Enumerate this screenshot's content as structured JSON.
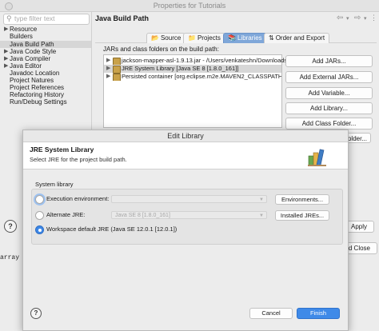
{
  "window": {
    "title": "Properties for Tutorials"
  },
  "sidebar": {
    "filter_placeholder": "type filter text",
    "items": [
      {
        "label": "Resource",
        "expandable": true
      },
      {
        "label": "Builders",
        "expandable": false
      },
      {
        "label": "Java Build Path",
        "expandable": false,
        "selected": true
      },
      {
        "label": "Java Code Style",
        "expandable": true
      },
      {
        "label": "Java Compiler",
        "expandable": true
      },
      {
        "label": "Java Editor",
        "expandable": true
      },
      {
        "label": "Javadoc Location",
        "expandable": false
      },
      {
        "label": "Project Natures",
        "expandable": false
      },
      {
        "label": "Project References",
        "expandable": false
      },
      {
        "label": "Refactoring History",
        "expandable": false
      },
      {
        "label": "Run/Debug Settings",
        "expandable": false
      }
    ]
  },
  "main": {
    "title": "Java Build Path",
    "tabs": [
      {
        "label": "Source",
        "icon": "source-folder-icon"
      },
      {
        "label": "Projects",
        "icon": "project-icon"
      },
      {
        "label": "Libraries",
        "icon": "library-icon",
        "active": true
      },
      {
        "label": "Order and Export",
        "icon": "order-icon"
      }
    ],
    "jars_label": "JARs and class folders on the build path:",
    "tree": [
      {
        "label": "jackson-mapper-asl-1.9.13.jar - /Users/venkateshn/Downloads"
      },
      {
        "label": "JRE System Library [Java SE 8 [1.8.0_161]]",
        "selected": true
      },
      {
        "label": "Persisted container [org.eclipse.m2e.MAVEN2_CLASSPATH_CO"
      }
    ],
    "buttons": [
      "Add JARs...",
      "Add External JARs...",
      "Add Variable...",
      "Add Library...",
      "Add Class Folder...",
      "Folder..."
    ],
    "apply_label": "Apply",
    "apply_close_label": "and Close",
    "fragment_text": "array"
  },
  "dialog": {
    "title": "Edit Library",
    "heading": "JRE System Library",
    "description": "Select JRE for the project build path.",
    "group_label": "System library",
    "options": [
      {
        "label": "Execution environment:",
        "value": "",
        "button": "Environments...",
        "checked": false
      },
      {
        "label": "Alternate JRE:",
        "value": "Java SE 8 [1.8.0_161]",
        "button": "Installed JREs...",
        "checked": false
      },
      {
        "label": "Workspace default JRE (Java SE 12.0.1 [12.0.1])",
        "checked": true
      }
    ],
    "cancel_label": "Cancel",
    "finish_label": "Finish",
    "help_symbol": "?"
  },
  "colors": {
    "accent": "#3f8ae8",
    "active_tab": "#7fa7d9"
  }
}
